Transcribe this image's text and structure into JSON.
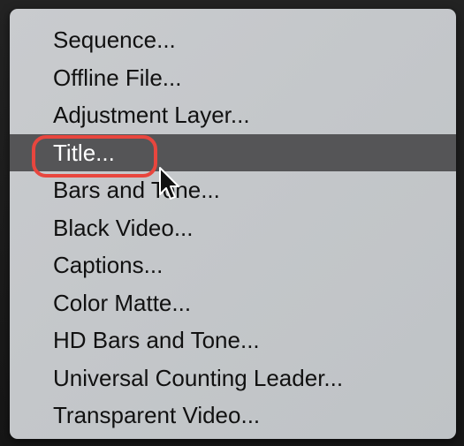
{
  "menu": {
    "items": [
      {
        "label": "Sequence..."
      },
      {
        "label": "Offline File..."
      },
      {
        "label": "Adjustment Layer..."
      },
      {
        "label": "Title...",
        "state": "highlighted",
        "annotated": true
      },
      {
        "label": "Bars and Tone..."
      },
      {
        "label": "Black Video..."
      },
      {
        "label": "Captions..."
      },
      {
        "label": "Color Matte..."
      },
      {
        "label": "HD Bars and Tone..."
      },
      {
        "label": "Universal Counting Leader..."
      },
      {
        "label": "Transparent Video..."
      }
    ],
    "colors": {
      "background": "#c5c8cb",
      "highlight": "#555557",
      "text": "#111111",
      "highlight_text": "#ffffff",
      "callout": "#e8463e"
    }
  },
  "cursor": {
    "icon": "arrow-pointer-icon"
  }
}
